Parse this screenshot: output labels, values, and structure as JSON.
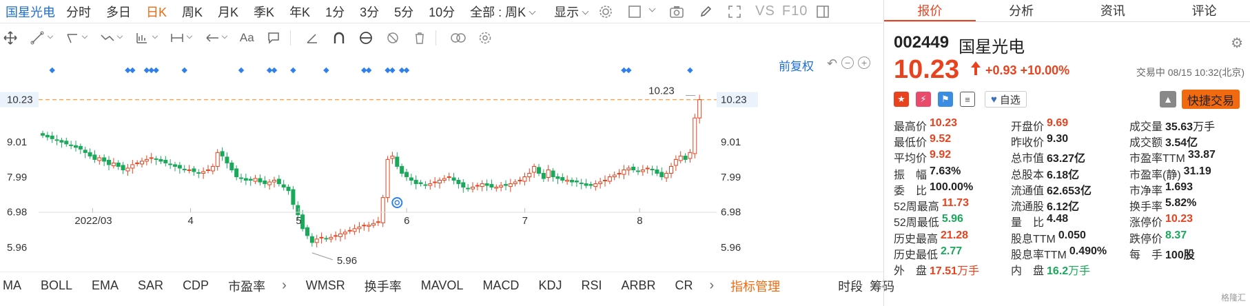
{
  "toolbar": {
    "symbol": "国星光电",
    "periods": [
      "分时",
      "多日",
      "日K",
      "周K",
      "月K",
      "季K",
      "年K",
      "1分",
      "3分",
      "5分",
      "10分"
    ],
    "active_period": "日K",
    "range_select": "全部 : 周K",
    "display_label": "显示",
    "vs_label": "VS",
    "f10_label": "F10"
  },
  "drawing_tools": {
    "text_tool": "Aa"
  },
  "chart": {
    "adjust_label": "前复权",
    "price_levels": [
      "10.23",
      "9.01",
      "7.99",
      "6.98",
      "5.96"
    ],
    "current_price_tag": "10.23",
    "high_annotation": "10.23",
    "low_annotation": "5.96",
    "x_labels": [
      "2022/03",
      "4",
      "5",
      "6",
      "7",
      "8"
    ]
  },
  "chart_data": {
    "type": "candlestick",
    "period": "daily",
    "ylim": [
      5.5,
      10.6
    ],
    "y_ticks": [
      5.96,
      6.98,
      7.99,
      9.01,
      10.23
    ],
    "x_ticks": [
      "2022/03",
      "4",
      "5",
      "6",
      "7",
      "8"
    ],
    "last_close": 10.23,
    "period_high": 10.23,
    "period_low": 5.96
  },
  "indicators": {
    "items": [
      "MA",
      "BOLL",
      "EMA",
      "SAR",
      "CDP",
      "市盈率",
      "WMSR",
      "换手率",
      "MAVOL",
      "MACD",
      "KDJ",
      "RSI",
      "ARBR",
      "CR"
    ],
    "manage_label": "指标管理",
    "extra_labels": [
      "时段",
      "筹码"
    ]
  },
  "panel": {
    "tabs": [
      "报价",
      "分析",
      "资讯",
      "评论"
    ],
    "active_tab": "报价",
    "code": "002449",
    "name": "国星光电",
    "price": "10.23",
    "change": "+0.93",
    "change_pct": "+10.00%",
    "status": "交易中 08/15 10:32(北京)",
    "watch_label": "自选",
    "quick_trade_label": "快捷交易",
    "stats": [
      [
        {
          "k": "最高价",
          "v": "10.23",
          "c": "red"
        },
        {
          "k": "开盘价",
          "v": "9.69",
          "c": "red"
        },
        {
          "k": "成交量",
          "v": "35.63",
          "u": "万手",
          "c": ""
        }
      ],
      [
        {
          "k": "最低价",
          "v": "9.52",
          "c": "red"
        },
        {
          "k": "昨收价",
          "v": "9.30",
          "c": ""
        },
        {
          "k": "成交额",
          "v": "3.54亿",
          "c": ""
        }
      ],
      [
        {
          "k": "平均价",
          "v": "9.92",
          "c": "red"
        },
        {
          "k": "总市值",
          "v": "63.27亿",
          "c": ""
        },
        {
          "k": "市盈率TTM",
          "v": "33.87",
          "c": ""
        }
      ],
      [
        {
          "k": "振　幅",
          "v": "7.63%",
          "c": ""
        },
        {
          "k": "总股本",
          "v": "6.18亿",
          "c": ""
        },
        {
          "k": "市盈率(静)",
          "v": "31.19",
          "c": ""
        }
      ],
      [
        {
          "k": "委　比",
          "v": "100.00%",
          "c": ""
        },
        {
          "k": "流通值",
          "v": "62.653亿",
          "c": ""
        },
        {
          "k": "市净率",
          "v": "1.693",
          "c": ""
        }
      ],
      [
        {
          "k": "52周最高",
          "v": "11.73",
          "c": "red"
        },
        {
          "k": "流通股",
          "v": "6.12亿",
          "c": ""
        },
        {
          "k": "换手率",
          "v": "5.82%",
          "c": ""
        }
      ],
      [
        {
          "k": "52周最低",
          "v": "5.96",
          "c": "green"
        },
        {
          "k": "量　比",
          "v": "4.48",
          "c": ""
        },
        {
          "k": "涨停价",
          "v": "10.23",
          "c": "red"
        }
      ],
      [
        {
          "k": "历史最高",
          "v": "21.28",
          "c": "red"
        },
        {
          "k": "股息TTM",
          "v": "0.050",
          "c": ""
        },
        {
          "k": "跌停价",
          "v": "8.37",
          "c": "green"
        }
      ],
      [
        {
          "k": "历史最低",
          "v": "2.77",
          "c": "green"
        },
        {
          "k": "股息率TTM",
          "v": "0.490%",
          "c": ""
        },
        {
          "k": "每　手",
          "v": "100股",
          "c": ""
        }
      ],
      [
        {
          "k": "外　盘",
          "v": "17.51",
          "u": "万手",
          "c": "red"
        },
        {
          "k": "内　盘",
          "v": "16.2",
          "u": "万手",
          "c": "green"
        },
        {
          "k": "",
          "v": "",
          "c": ""
        }
      ]
    ]
  },
  "colors": {
    "up": "#e8421e",
    "down": "#1aa85a",
    "accent": "#f26a10",
    "link": "#1f6fd0"
  }
}
